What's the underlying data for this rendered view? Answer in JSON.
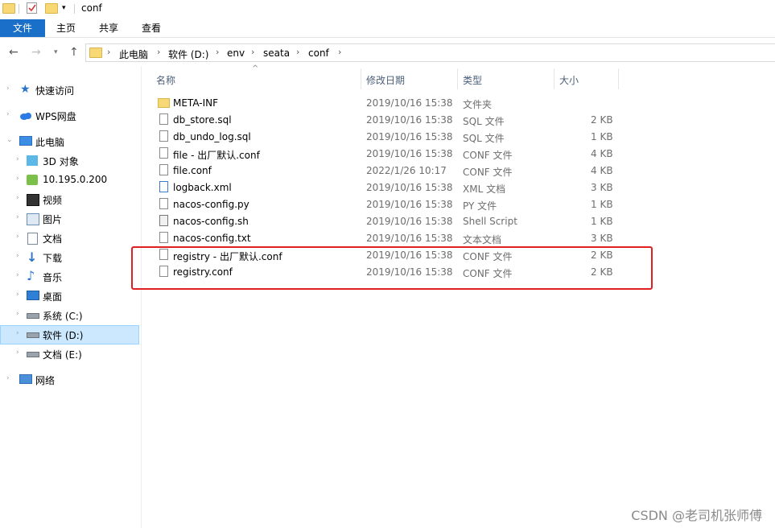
{
  "window": {
    "title": "conf"
  },
  "ribbon": {
    "tabs": [
      "文件",
      "主页",
      "共享",
      "查看"
    ]
  },
  "address": {
    "breadcrumbs": [
      "此电脑",
      "软件 (D:)",
      "env",
      "seata",
      "conf"
    ]
  },
  "nav": {
    "items": [
      {
        "label": "快速访问",
        "icon": "star-icon"
      },
      {
        "label": "WPS网盘",
        "icon": "cloud-icon"
      },
      {
        "label": "此电脑",
        "icon": "computer-icon"
      },
      {
        "label": "3D 对象",
        "icon": "cube-icon"
      },
      {
        "label": "10.195.0.200",
        "icon": "network-drive-icon"
      },
      {
        "label": "视频",
        "icon": "video-icon"
      },
      {
        "label": "图片",
        "icon": "picture-icon"
      },
      {
        "label": "文档",
        "icon": "document-icon"
      },
      {
        "label": "下载",
        "icon": "download-icon"
      },
      {
        "label": "音乐",
        "icon": "music-icon"
      },
      {
        "label": "桌面",
        "icon": "desktop-icon"
      },
      {
        "label": "系统 (C:)",
        "icon": "drive-icon"
      },
      {
        "label": "软件 (D:)",
        "icon": "drive-icon",
        "selected": true
      },
      {
        "label": "文档 (E:)",
        "icon": "drive-icon"
      },
      {
        "label": "网络",
        "icon": "network-icon"
      }
    ]
  },
  "list": {
    "columns": [
      "名称",
      "修改日期",
      "类型",
      "大小"
    ],
    "rows": [
      {
        "name": "META-INF",
        "date": "2019/10/16 15:38",
        "type": "文件夹",
        "size": ""
      },
      {
        "name": "db_store.sql",
        "date": "2019/10/16 15:38",
        "type": "SQL 文件",
        "size": "2 KB"
      },
      {
        "name": "db_undo_log.sql",
        "date": "2019/10/16 15:38",
        "type": "SQL 文件",
        "size": "1 KB"
      },
      {
        "name": "file - 出厂默认.conf",
        "date": "2019/10/16 15:38",
        "type": "CONF 文件",
        "size": "4 KB"
      },
      {
        "name": "file.conf",
        "date": "2022/1/26 10:17",
        "type": "CONF 文件",
        "size": "4 KB"
      },
      {
        "name": "logback.xml",
        "date": "2019/10/16 15:38",
        "type": "XML 文档",
        "size": "3 KB"
      },
      {
        "name": "nacos-config.py",
        "date": "2019/10/16 15:38",
        "type": "PY 文件",
        "size": "1 KB"
      },
      {
        "name": "nacos-config.sh",
        "date": "2019/10/16 15:38",
        "type": "Shell Script",
        "size": "1 KB"
      },
      {
        "name": "nacos-config.txt",
        "date": "2019/10/16 15:38",
        "type": "文本文档",
        "size": "3 KB"
      },
      {
        "name": "registry - 出厂默认.conf",
        "date": "2019/10/16 15:38",
        "type": "CONF 文件",
        "size": "2 KB"
      },
      {
        "name": "registry.conf",
        "date": "2019/10/16 15:38",
        "type": "CONF 文件",
        "size": "2 KB"
      }
    ]
  },
  "watermark": "CSDN @老司机张师傅",
  "colors": {
    "accent": "#1a6fc9",
    "selection": "#cce8ff",
    "highlight": "#e02020"
  }
}
